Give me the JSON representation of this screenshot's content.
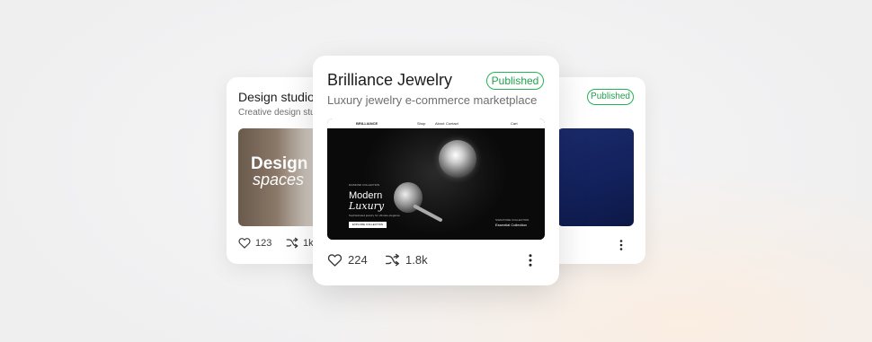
{
  "cards": {
    "left": {
      "title": "Design studio",
      "subtitle": "Creative design stu",
      "thumbnail": {
        "headline": "Design f",
        "subheadline": "spaces"
      },
      "likes": "123",
      "remixes": "1k"
    },
    "main": {
      "title": "Brilliance Jewelry",
      "subtitle": "Luxury jewelry e-commerce marketplace",
      "status": "Published",
      "likes": "224",
      "remixes": "1.8k",
      "thumbnail": {
        "brand": "BRILLIANCE",
        "nav": [
          "Shop",
          "About",
          "Contact"
        ],
        "cart": "Cart",
        "eyebrow": "DIAMOND COLLECTION",
        "headline_1": "Modern",
        "headline_2": "Luxury",
        "tagline": "Sophisticated jewelry for ultimate elegance",
        "cta": "EXPLORE COLLECTION",
        "right_eyebrow": "SIGNATURE COLLECTION",
        "right_title": "Essential Collection"
      }
    },
    "right": {
      "status": "Published"
    }
  },
  "colors": {
    "published_green": "#22a04e",
    "text_primary": "#1c1c1e",
    "text_secondary": "#6f6f72"
  },
  "icons": {
    "like": "heart-icon",
    "remix": "shuffle-icon",
    "more": "more-vertical-icon"
  }
}
